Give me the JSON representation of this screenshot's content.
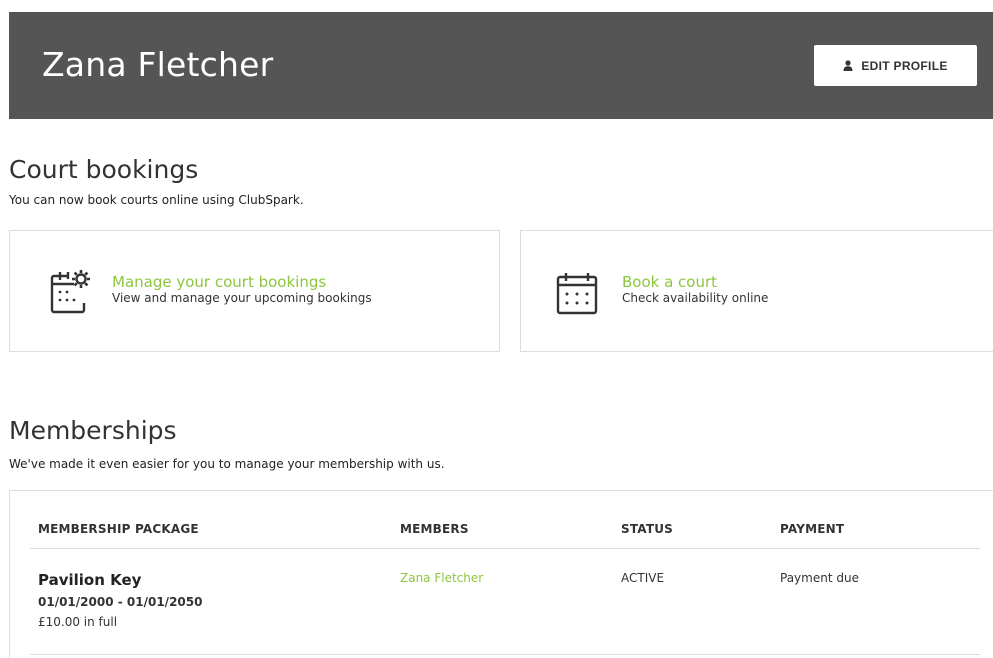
{
  "header": {
    "name": "Zana Fletcher",
    "edit_button": "EDIT PROFILE",
    "edit_icon": "person-icon"
  },
  "court_bookings": {
    "title": "Court bookings",
    "subtitle": "You can now book courts online using ClubSpark.",
    "cards": [
      {
        "title": "Manage your court bookings",
        "description": "View and manage your upcoming bookings",
        "icon": "calendar-gear-icon"
      },
      {
        "title": "Book a court",
        "description": "Check availability online",
        "icon": "calendar-icon"
      }
    ]
  },
  "memberships": {
    "title": "Memberships",
    "subtitle": "We've made it even easier for you to manage your membership with us.",
    "columns": [
      "MEMBERSHIP PACKAGE",
      "MEMBERS",
      "STATUS",
      "PAYMENT"
    ],
    "rows": [
      {
        "package": "Pavilion Key",
        "dates": "01/01/2000 - 01/01/2050",
        "price": "£10.00 in full",
        "member": "Zana Fletcher",
        "status": "ACTIVE",
        "payment": "Payment due"
      }
    ]
  },
  "colors": {
    "header_bg": "#555555",
    "accent_green": "#8cc63f",
    "border": "#dddddd"
  }
}
